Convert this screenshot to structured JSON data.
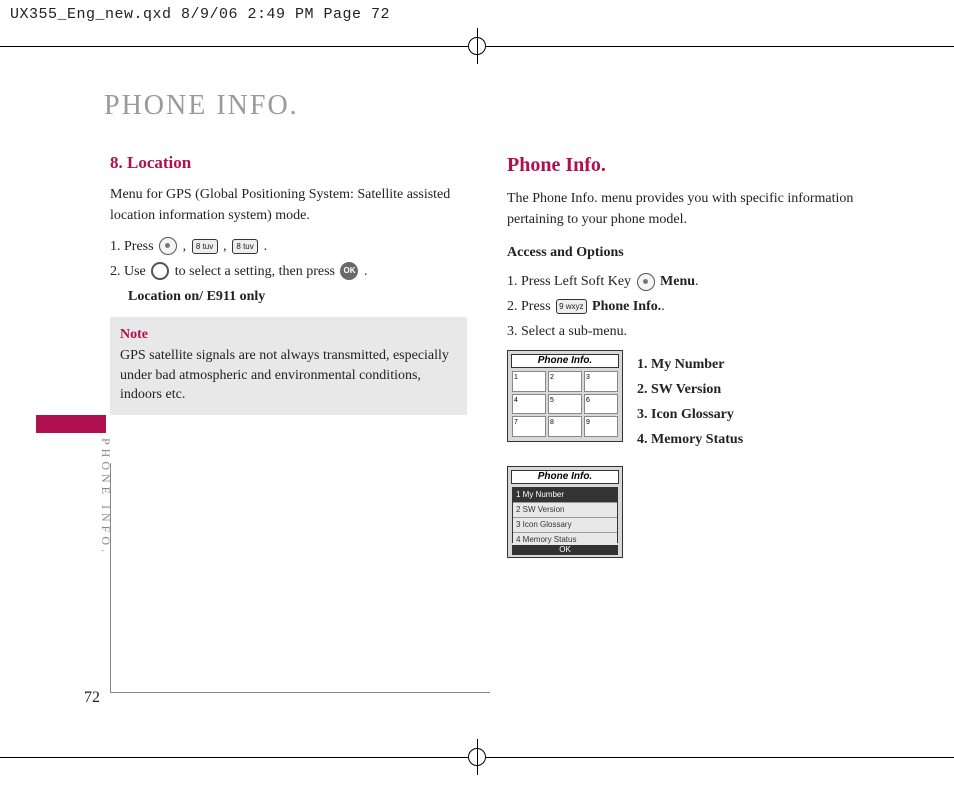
{
  "crop_header": "UX355_Eng_new.qxd  8/9/06  2:49 PM  Page 72",
  "main_title": "PHONE INFO.",
  "side_label": "PHONE INFO.",
  "page_number": "72",
  "left": {
    "heading": "8. Location",
    "intro": "Menu for GPS (Global Positioning System: Satellite assisted location information system) mode.",
    "step1_a": "1. Press ",
    "step1_b": " , ",
    "step1_c": " , ",
    "step1_d": " .",
    "key8a": "8 tuv",
    "key8b": "8 tuv",
    "step2_a": "2. Use ",
    "step2_b": " to select a setting, then press ",
    "step2_c": " .",
    "ok_label": "OK",
    "setting_line": "Location on/ E911 only",
    "note_title": "Note",
    "note_body": "GPS satellite signals are not always transmitted, especially under bad atmospheric and environmental conditions, indoors etc."
  },
  "right": {
    "heading": "Phone Info.",
    "intro": "The Phone Info. menu provides you with specific information pertaining to your phone model.",
    "access_heading": "Access and Options",
    "step1_a": "1. Press Left Soft Key ",
    "step1_b": "Menu",
    "step1_c": ".",
    "step2_a": "2. Press ",
    "key9": "9 wxyz",
    "step2_b": "Phone Info.",
    "step2_c": ".",
    "step3": "3. Select a sub-menu.",
    "screenshot1_title": "Phone Info.",
    "grid_cells": [
      "1",
      "2",
      "3",
      "4",
      "5",
      "6",
      "7",
      "8",
      "9"
    ],
    "submenu": {
      "i1": "1. My Number",
      "i2": "2. SW Version",
      "i3": "3. Icon Glossary",
      "i4": "4. Memory Status"
    },
    "screenshot2": {
      "title": "Phone Info.",
      "rows": [
        "1 My Number",
        "2 SW Version",
        "3 Icon Glossary",
        "4 Memory Status"
      ],
      "softkey": "OK"
    }
  }
}
